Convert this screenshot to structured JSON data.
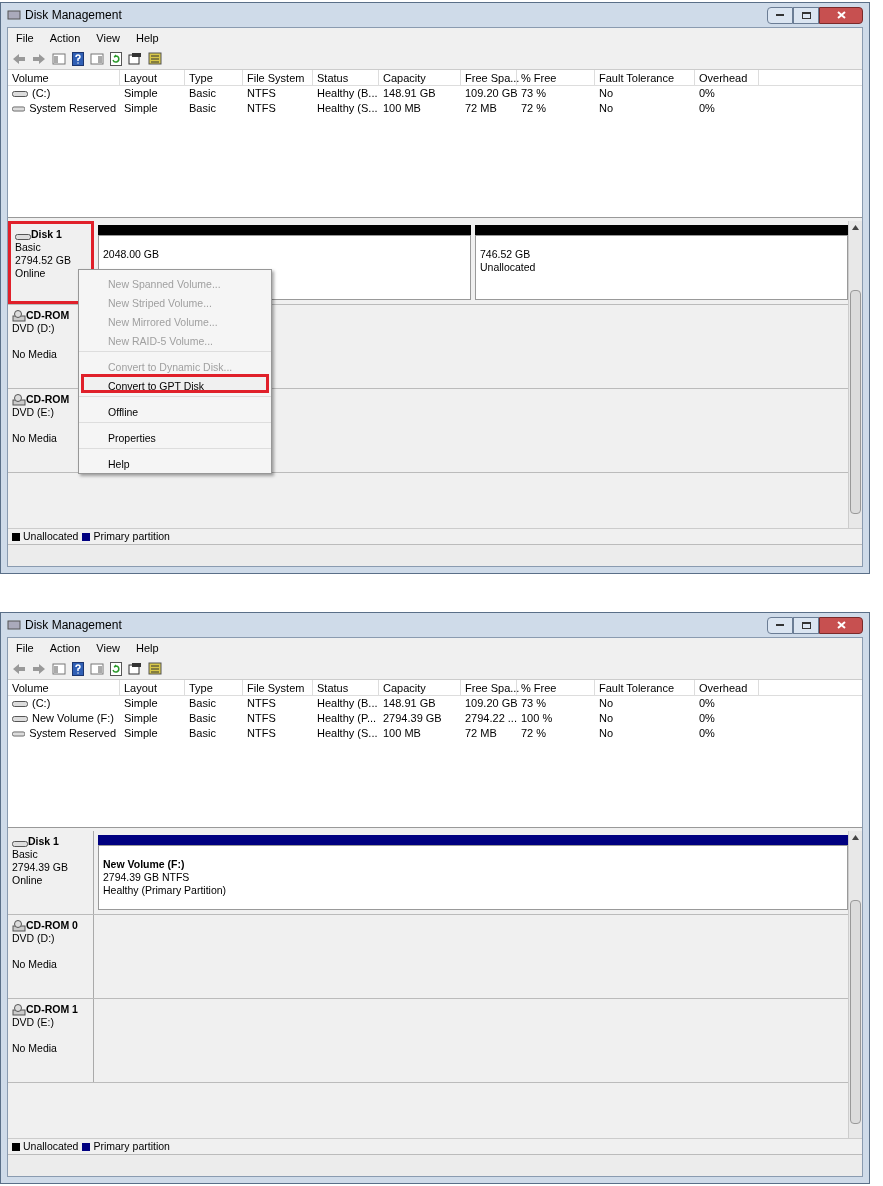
{
  "windows": [
    {
      "title": "Disk Management",
      "menu": [
        "File",
        "Action",
        "View",
        "Help"
      ],
      "columns": [
        "Volume",
        "Layout",
        "Type",
        "File System",
        "Status",
        "Capacity",
        "Free Spa...",
        "% Free",
        "Fault Tolerance",
        "Overhead"
      ],
      "rows": [
        [
          "(C:)",
          "Simple",
          "Basic",
          "NTFS",
          "Healthy (B...",
          "148.91 GB",
          "109.20 GB",
          "73 %",
          "No",
          "0%"
        ],
        [
          "System Reserved",
          "Simple",
          "Basic",
          "NTFS",
          "Healthy (S...",
          "100 MB",
          "72 MB",
          "72 %",
          "No",
          "0%"
        ]
      ],
      "disks": [
        {
          "kind": "disk",
          "name": "Disk 1",
          "lines": [
            "Basic",
            "2794.52 GB",
            "Online"
          ],
          "highlighted": true,
          "partitions": [
            {
              "color": "#000000",
              "lines": [
                "2048.00 GB"
              ]
            },
            {
              "color": "#000000",
              "lines": [
                "746.52 GB",
                "Unallocated"
              ]
            }
          ]
        },
        {
          "kind": "cdrom",
          "name": "CD-ROM",
          "lines": [
            "DVD (D:)",
            "No Media"
          ],
          "highlighted": false
        },
        {
          "kind": "cdrom",
          "name": "CD-ROM",
          "lines": [
            "DVD (E:)",
            "No Media"
          ],
          "highlighted": false
        }
      ],
      "context_menu": {
        "items": [
          {
            "label": "New Spanned Volume...",
            "disabled": true,
            "highlighted": false,
            "separator_before": false
          },
          {
            "label": "New Striped Volume...",
            "disabled": true,
            "highlighted": false,
            "separator_before": false
          },
          {
            "label": "New Mirrored Volume...",
            "disabled": true,
            "highlighted": false,
            "separator_before": false
          },
          {
            "label": "New RAID-5 Volume...",
            "disabled": true,
            "highlighted": false,
            "separator_before": false
          },
          {
            "label": "Convert to Dynamic Disk...",
            "disabled": true,
            "highlighted": false,
            "separator_before": true
          },
          {
            "label": "Convert to GPT Disk",
            "disabled": false,
            "highlighted": true,
            "separator_before": false
          },
          {
            "label": "Offline",
            "disabled": false,
            "highlighted": false,
            "separator_before": true
          },
          {
            "label": "Properties",
            "disabled": false,
            "highlighted": false,
            "separator_before": true
          },
          {
            "label": "Help",
            "disabled": false,
            "highlighted": false,
            "separator_before": true
          }
        ]
      },
      "legend": [
        {
          "label": "Unallocated",
          "color": "#000000"
        },
        {
          "label": "Primary partition",
          "color": "#000080"
        }
      ]
    },
    {
      "title": "Disk Management",
      "menu": [
        "File",
        "Action",
        "View",
        "Help"
      ],
      "columns": [
        "Volume",
        "Layout",
        "Type",
        "File System",
        "Status",
        "Capacity",
        "Free Spa...",
        "% Free",
        "Fault Tolerance",
        "Overhead"
      ],
      "rows": [
        [
          "(C:)",
          "Simple",
          "Basic",
          "NTFS",
          "Healthy (B...",
          "148.91 GB",
          "109.20 GB",
          "73 %",
          "No",
          "0%"
        ],
        [
          "New Volume (F:)",
          "Simple",
          "Basic",
          "NTFS",
          "Healthy (P...",
          "2794.39 GB",
          "2794.22 ...",
          "100 %",
          "No",
          "0%"
        ],
        [
          "System Reserved",
          "Simple",
          "Basic",
          "NTFS",
          "Healthy (S...",
          "100 MB",
          "72 MB",
          "72 %",
          "No",
          "0%"
        ]
      ],
      "disks": [
        {
          "kind": "disk",
          "name": "Disk 1",
          "lines": [
            "Basic",
            "2794.39 GB",
            "Online"
          ],
          "highlighted": false,
          "partitions": [
            {
              "color": "#000080",
              "bold_line": "New Volume  (F:)",
              "lines": [
                "2794.39 GB NTFS",
                "Healthy (Primary Partition)"
              ]
            }
          ]
        },
        {
          "kind": "cdrom",
          "name": "CD-ROM 0",
          "lines": [
            "DVD (D:)",
            "No Media"
          ],
          "highlighted": false
        },
        {
          "kind": "cdrom",
          "name": "CD-ROM 1",
          "lines": [
            "DVD (E:)",
            "No Media"
          ],
          "highlighted": false
        }
      ],
      "legend": [
        {
          "label": "Unallocated",
          "color": "#000000"
        },
        {
          "label": "Primary partition",
          "color": "#000080"
        }
      ]
    }
  ]
}
